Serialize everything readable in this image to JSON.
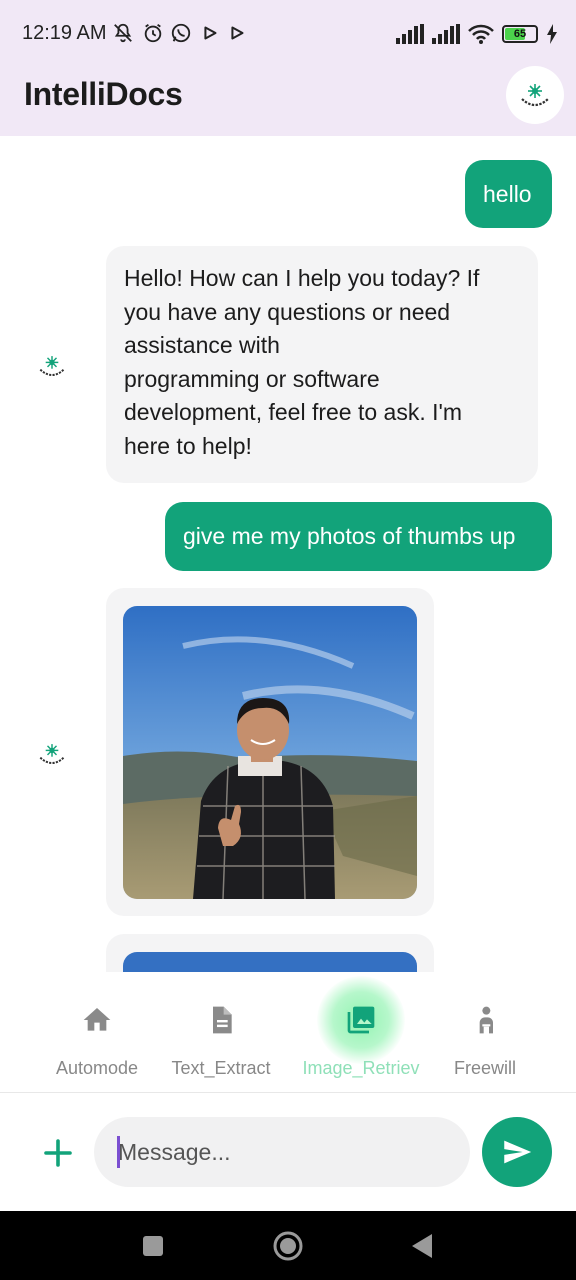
{
  "status_bar": {
    "time": "12:19 AM",
    "battery": "65",
    "icons": [
      "mute-icon",
      "alarm-icon",
      "whatsapp-icon",
      "play-icon",
      "play-icon",
      "signal-icon",
      "signal-icon",
      "wifi-icon",
      "battery-icon",
      "charging-icon"
    ]
  },
  "app_bar": {
    "title": "IntelliDocs",
    "logo_icon": "intellidocs-logo-icon"
  },
  "messages": [
    {
      "role": "user",
      "text": "hello"
    },
    {
      "role": "bot",
      "text": "Hello! How can I help you today? If\nyou have any questions or need\nassistance with\nprogramming or software\ndevelopment, feel free to ask. I'm\nhere to help!"
    },
    {
      "role": "user",
      "text": "give me my photos of thumbs up"
    },
    {
      "role": "bot",
      "type": "image",
      "alt": "photo"
    },
    {
      "role": "bot",
      "type": "image",
      "alt": "photo"
    }
  ],
  "nav": {
    "items": [
      {
        "label": "Automode",
        "icon": "home-icon",
        "active": false
      },
      {
        "label": "Text_Extract",
        "icon": "document-icon",
        "active": false
      },
      {
        "label": "Image_Retriev",
        "icon": "photo-library-icon",
        "active": true
      },
      {
        "label": "Freewill",
        "icon": "person-icon",
        "active": false
      }
    ]
  },
  "composer": {
    "placeholder": "Message...",
    "value": "",
    "add_icon": "plus-icon",
    "send_icon": "send-icon"
  },
  "colors": {
    "accent": "#12a37a",
    "app_bar_bg": "#f1e8f6",
    "bot_bubble": "#f4f4f5",
    "active_nav": "#8fe0b8"
  }
}
